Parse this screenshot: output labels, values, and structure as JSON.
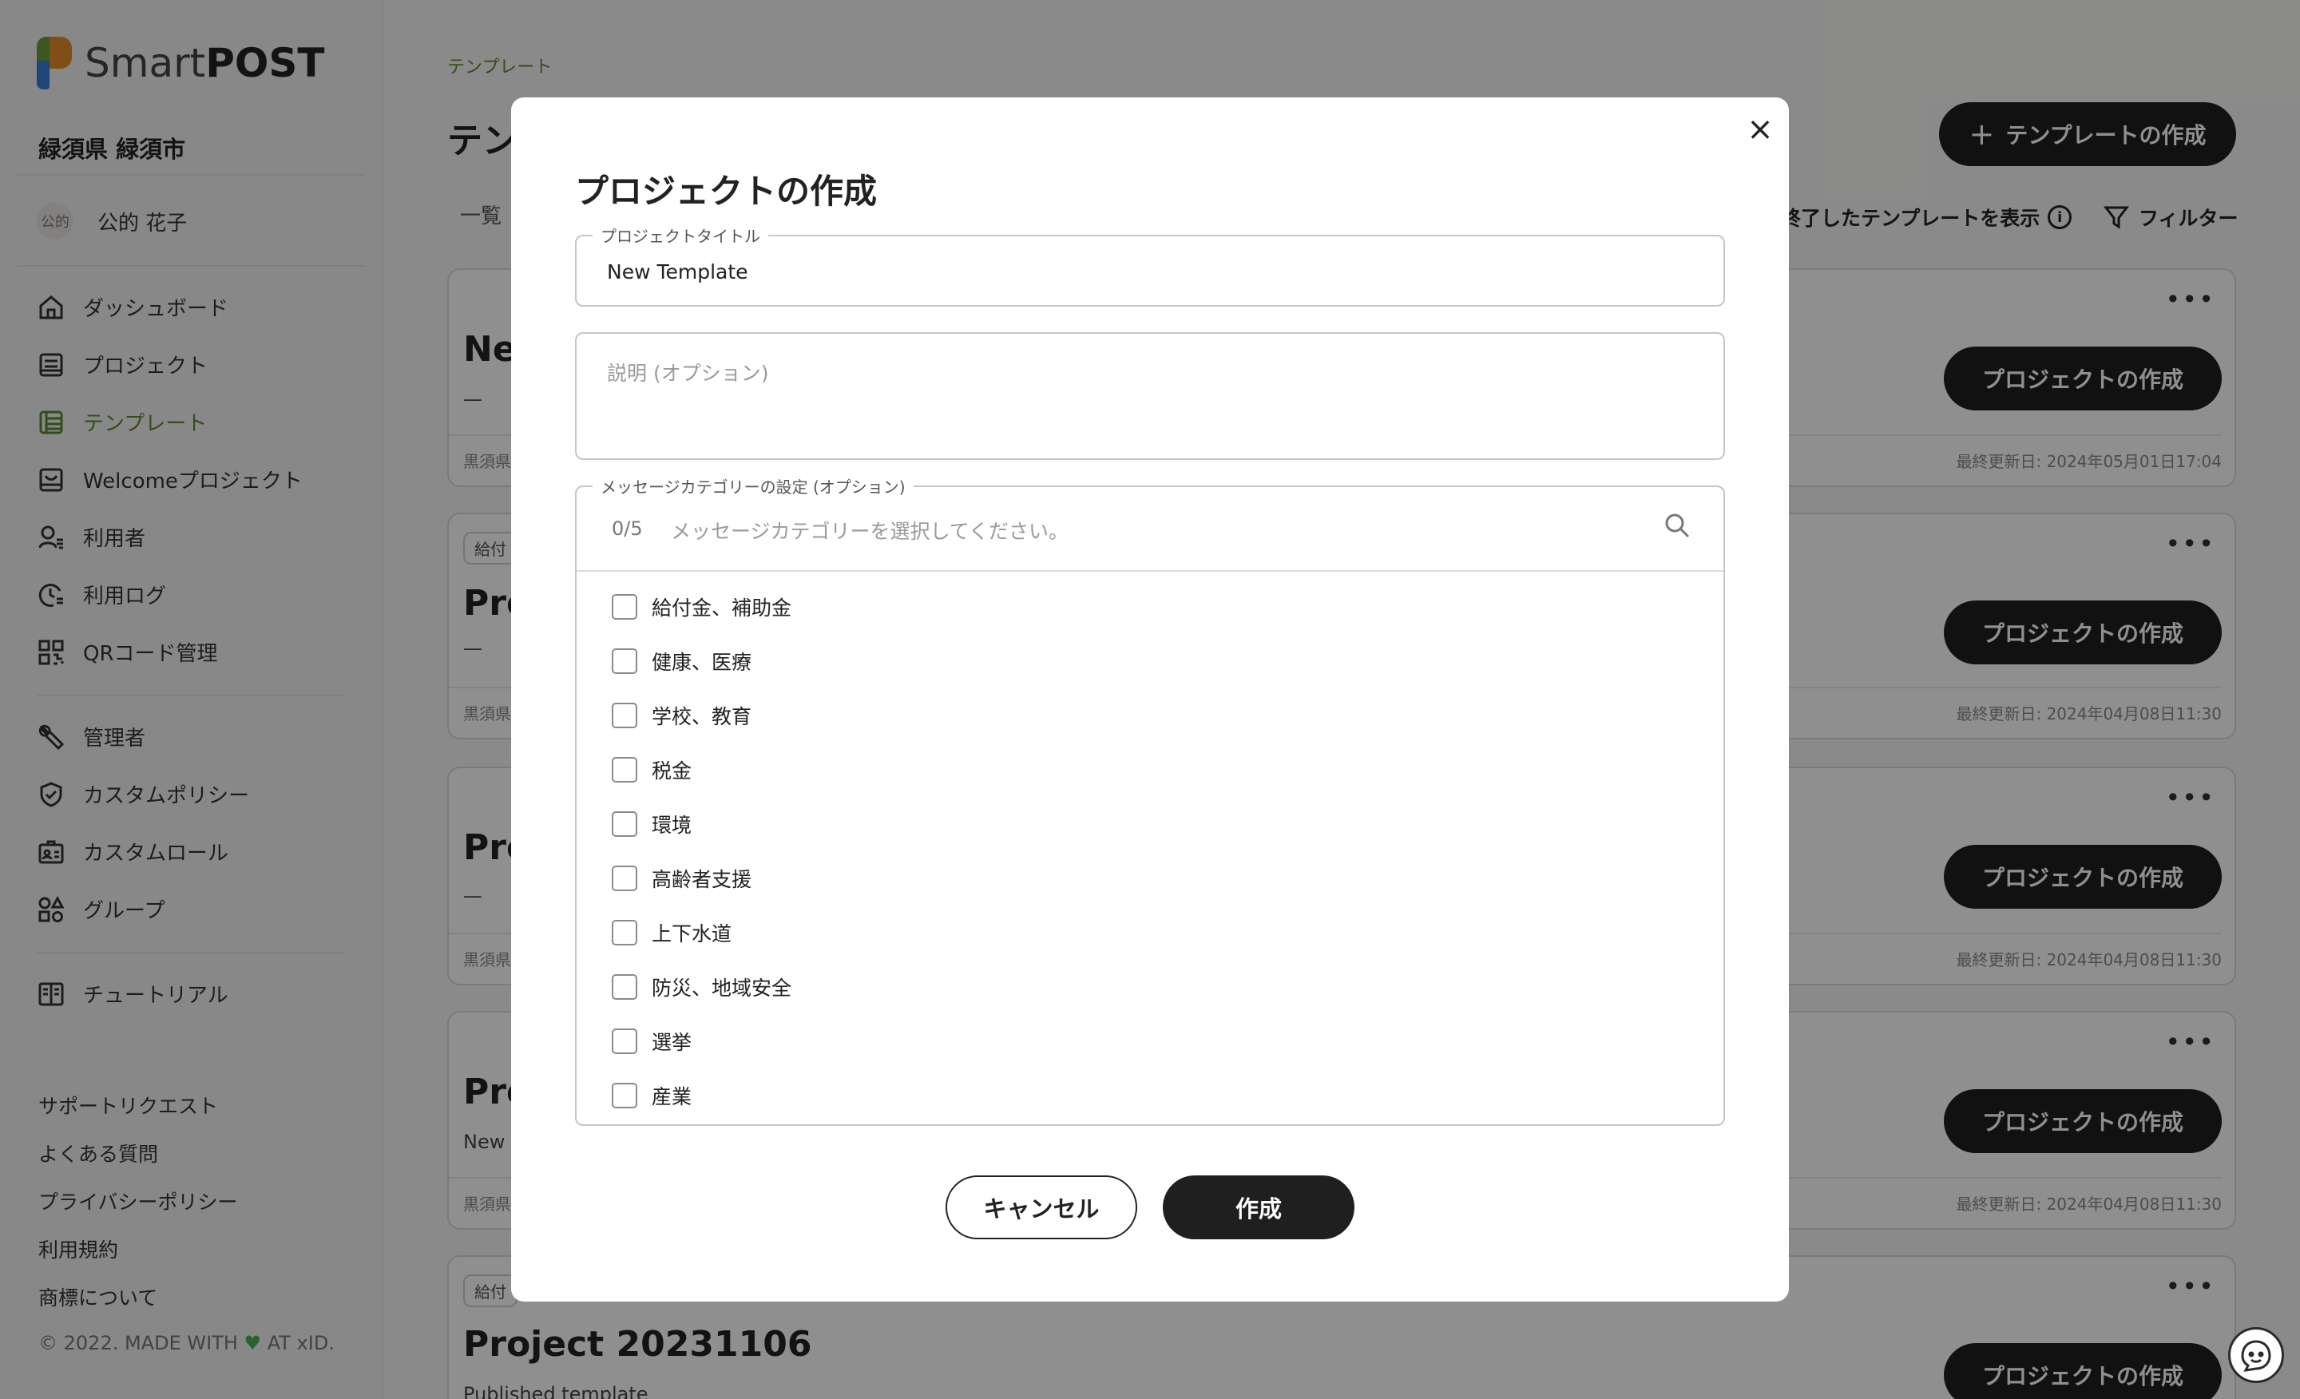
{
  "brand": {
    "logo_regular": "Smart",
    "logo_bold": "POST"
  },
  "sidebar": {
    "org_name": "緑須県 緑須市",
    "user": {
      "avatar": "公的",
      "name": "公的 花子"
    },
    "items": [
      {
        "label": "ダッシュボード",
        "icon": "home-icon"
      },
      {
        "label": "プロジェクト",
        "icon": "project-icon"
      },
      {
        "label": "テンプレート",
        "icon": "template-icon",
        "active": true
      },
      {
        "label": "Welcomeプロジェクト",
        "icon": "welcome-project-icon"
      },
      {
        "label": "利用者",
        "icon": "user-icon"
      },
      {
        "label": "利用ログ",
        "icon": "log-icon"
      },
      {
        "label": "QRコード管理",
        "icon": "qr-code-icon"
      },
      {
        "label": "管理者",
        "icon": "wrench-icon"
      },
      {
        "label": "カスタムポリシー",
        "icon": "shield-icon"
      },
      {
        "label": "カスタムロール",
        "icon": "id-card-icon"
      },
      {
        "label": "グループ",
        "icon": "group-icon"
      },
      {
        "label": "チュートリアル",
        "icon": "book-icon"
      }
    ],
    "footer_links": [
      "サポートリクエスト",
      "よくある質問",
      "プライバシーポリシー",
      "利用規約",
      "商標について"
    ],
    "copyright_before": "© 2022. MADE WITH",
    "copyright_after": "AT xID."
  },
  "main": {
    "breadcrumb": "テンプレート",
    "title_partial": "テン",
    "create_template_button": "テンプレートの作成",
    "tab_list": "一覧",
    "show_ended": "終了したテンプレートを表示",
    "filter": "フィルター",
    "cards": [
      {
        "title": "New",
        "subtitle": "—",
        "tag": "",
        "org": "黒須県",
        "updated": "最終更新日: 2024年05月01日17:04",
        "button": "プロジェクトの作成"
      },
      {
        "title": "Pro",
        "subtitle": "—",
        "tag": "給付",
        "org": "黒須県",
        "updated": "最終更新日: 2024年04月08日11:30",
        "button": "プロジェクトの作成"
      },
      {
        "title": "Pro",
        "subtitle": "—",
        "tag": "",
        "org": "黒須県",
        "updated": "最終更新日: 2024年04月08日11:30",
        "button": "プロジェクトの作成"
      },
      {
        "title": "Pro",
        "subtitle": "New T",
        "tag": "",
        "org": "黒須県",
        "updated": "最終更新日: 2024年04月08日11:30",
        "button": "プロジェクトの作成"
      },
      {
        "title": "Project 20231106",
        "subtitle": "Published template",
        "tag": "給付",
        "org": "",
        "updated": "",
        "button": "プロジェクトの作成"
      }
    ]
  },
  "modal": {
    "title": "プロジェクトの作成",
    "close_glyph": "×",
    "project_title_label": "プロジェクトタイトル",
    "project_title_value": "New Template",
    "description_placeholder": "説明 (オプション)",
    "category_label": "メッセージカテゴリーの設定 (オプション)",
    "category_count": "0/5",
    "category_placeholder": "メッセージカテゴリーを選択してください。",
    "categories": [
      "給付金、補助金",
      "健康、医療",
      "学校、教育",
      "税金",
      "環境",
      "高齢者支援",
      "上下水道",
      "防災、地域安全",
      "選挙",
      "産業"
    ],
    "cancel": "キャンセル",
    "create": "作成"
  },
  "colors": {
    "accent_green": "#5a8a2e",
    "dark_button": "#1f1f1f",
    "overlay": "rgba(0,0,0,0.44)"
  }
}
